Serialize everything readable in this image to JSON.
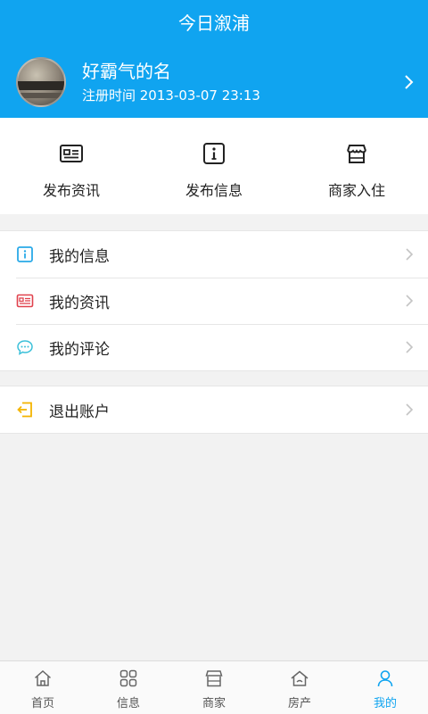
{
  "header": {
    "title": "今日溆浦"
  },
  "profile": {
    "name": "好霸气的名",
    "registered": "注册时间 2013-03-07 23:13"
  },
  "quick_actions": [
    {
      "label": "发布资讯",
      "icon": "news-card-icon"
    },
    {
      "label": "发布信息",
      "icon": "info-icon"
    },
    {
      "label": "商家入住",
      "icon": "storefront-icon"
    }
  ],
  "menu": {
    "my_info": "我的信息",
    "my_news": "我的资讯",
    "my_comments": "我的评论",
    "logout": "退出账户"
  },
  "bottom_nav": [
    {
      "label": "首页",
      "icon": "home-icon"
    },
    {
      "label": "信息",
      "icon": "grid-icon"
    },
    {
      "label": "商家",
      "icon": "store-icon"
    },
    {
      "label": "房产",
      "icon": "house-icon"
    },
    {
      "label": "我的",
      "icon": "person-icon",
      "active": true
    }
  ],
  "colors": {
    "primary": "#10a4f0",
    "info_icon": "#29a9e8",
    "news_icon": "#e0424d",
    "comment_icon": "#3bc0d9",
    "logout_icon": "#f4b400"
  }
}
